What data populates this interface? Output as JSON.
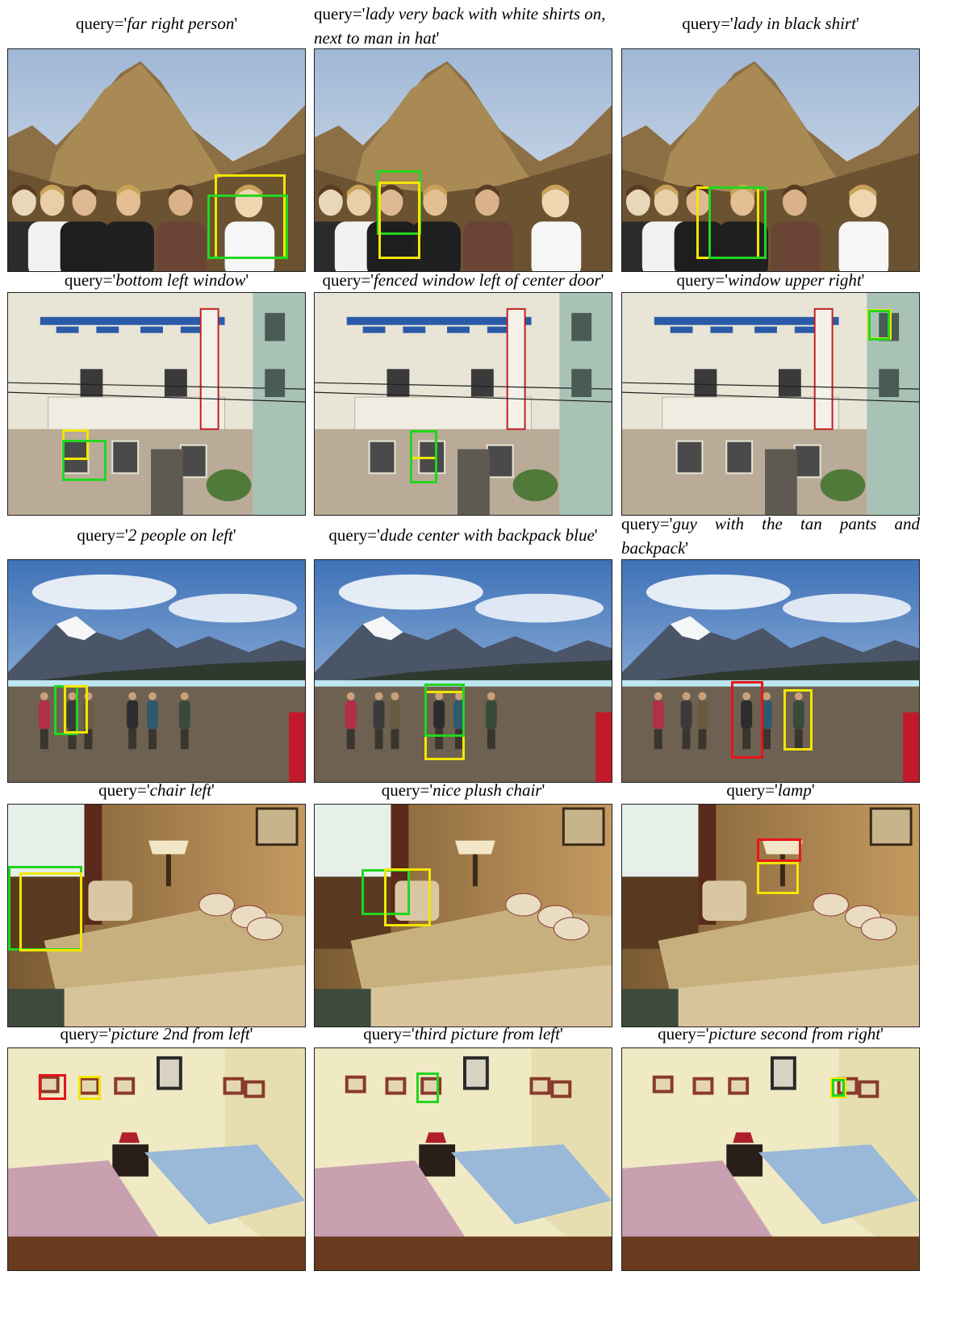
{
  "caption_prefix": "query='",
  "caption_suffix": "'",
  "box_colors": {
    "yellow": "#f2e600",
    "green": "#22d61e",
    "red": "#e8141a"
  },
  "rows": [
    {
      "scene": "mountain-people",
      "cells": [
        {
          "query": "far right person",
          "boxes": [
            {
              "color": "yellow"
            },
            {
              "color": "green"
            }
          ]
        },
        {
          "query": "lady very back with white shirts on, next to man in hat",
          "boxes": [
            {
              "color": "green"
            },
            {
              "color": "yellow"
            }
          ]
        },
        {
          "query": "lady in black shirt",
          "boxes": [
            {
              "color": "yellow"
            },
            {
              "color": "green"
            }
          ]
        }
      ]
    },
    {
      "scene": "hotel-facade",
      "cells": [
        {
          "query": "bottom left window",
          "boxes": [
            {
              "color": "yellow"
            },
            {
              "color": "green"
            }
          ]
        },
        {
          "query": "fenced window left of center door",
          "boxes": [
            {
              "color": "yellow"
            },
            {
              "color": "green"
            }
          ]
        },
        {
          "query": "window upper right",
          "boxes": [
            {
              "color": "yellow"
            },
            {
              "color": "green"
            }
          ]
        }
      ]
    },
    {
      "scene": "glacier-hikers",
      "cells": [
        {
          "query": "2 people on left",
          "boxes": [
            {
              "color": "green"
            },
            {
              "color": "yellow"
            }
          ]
        },
        {
          "query": "dude center with backpack blue",
          "boxes": [
            {
              "color": "yellow"
            },
            {
              "color": "green"
            }
          ]
        },
        {
          "query": "guy with the tan pants and backpack",
          "boxes": [
            {
              "color": "red"
            },
            {
              "color": "yellow"
            }
          ]
        }
      ]
    },
    {
      "scene": "hotel-bedroom",
      "cells": [
        {
          "query": "chair left",
          "boxes": [
            {
              "color": "green"
            },
            {
              "color": "yellow"
            }
          ]
        },
        {
          "query": "nice plush chair",
          "boxes": [
            {
              "color": "green"
            },
            {
              "color": "yellow"
            }
          ]
        },
        {
          "query": "lamp",
          "boxes": [
            {
              "color": "red"
            },
            {
              "color": "yellow"
            }
          ]
        }
      ]
    },
    {
      "scene": "twin-bedroom",
      "cells": [
        {
          "query": "picture 2nd from left",
          "boxes": [
            {
              "color": "red"
            },
            {
              "color": "yellow"
            }
          ]
        },
        {
          "query": "third picture from left",
          "boxes": [
            {
              "color": "green"
            }
          ]
        },
        {
          "query": "picture second from right",
          "boxes": [
            {
              "color": "yellow"
            },
            {
              "color": "green"
            }
          ]
        }
      ]
    }
  ]
}
